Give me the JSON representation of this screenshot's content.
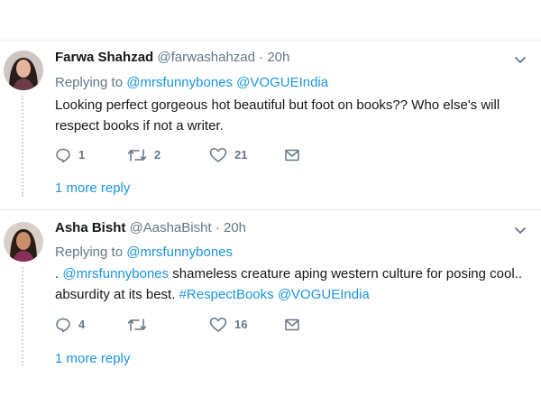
{
  "tweets": [
    {
      "name": "Farwa Shahzad",
      "handle": "@farwashahzad",
      "separator": "·",
      "time": "20h",
      "replying_prefix": "Replying to",
      "replying_to": [
        "@mrsfunnybones",
        "@VOGUEIndia"
      ],
      "text": "Looking perfect  gorgeous hot beautiful but foot on books?? Who else's will respect books if not a writer.",
      "reply_count": "1",
      "retweet_count": "2",
      "like_count": "21",
      "more_replies": "1 more reply"
    },
    {
      "name": "Asha Bisht",
      "handle": "@AashaBisht",
      "separator": "·",
      "time": "20h",
      "replying_prefix": "Replying to",
      "replying_to": [
        "@mrsfunnybones"
      ],
      "text_prefix": ". ",
      "text_mention": "@mrsfunnybones",
      "text_middle": " shameless creature aping western culture for posing cool.. absurdity at its best. ",
      "text_hashtag": "#RespectBooks",
      "text_space": " ",
      "text_mention2": "@VOGUEIndia",
      "reply_count": "4",
      "retweet_count": "",
      "like_count": "16",
      "more_replies": "1 more reply"
    }
  ],
  "colors": {
    "link": "#1b95e0",
    "secondary": "#657786",
    "divider": "#e1e8ed",
    "text": "#14171a"
  },
  "icons": [
    "caret-down-icon",
    "reply-icon",
    "retweet-icon",
    "like-icon",
    "dm-icon"
  ]
}
